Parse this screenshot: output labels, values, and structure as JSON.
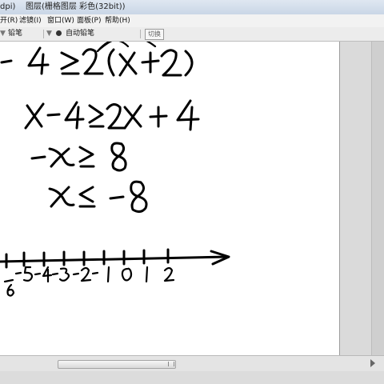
{
  "window": {
    "title_left": "dpi)",
    "title_layer": "图层(栅格图层 彩色(32bit))",
    "title_faded_1": "",
    "title_faded_2": ""
  },
  "menu": {
    "items": [
      {
        "label": "开(R)"
      },
      {
        "label": "滤镜(I)"
      },
      {
        "label": "窗口(W)"
      },
      {
        "label": "面板(P)"
      },
      {
        "label": "帮助(H)"
      }
    ]
  },
  "toolbar": {
    "tool_label": "铅笔",
    "mode_label": "自动铅笔",
    "button_label": "切换"
  },
  "icons": {
    "tool_dot": "radio-dot-icon",
    "mode_dot": "radio-dot-icon"
  }
}
